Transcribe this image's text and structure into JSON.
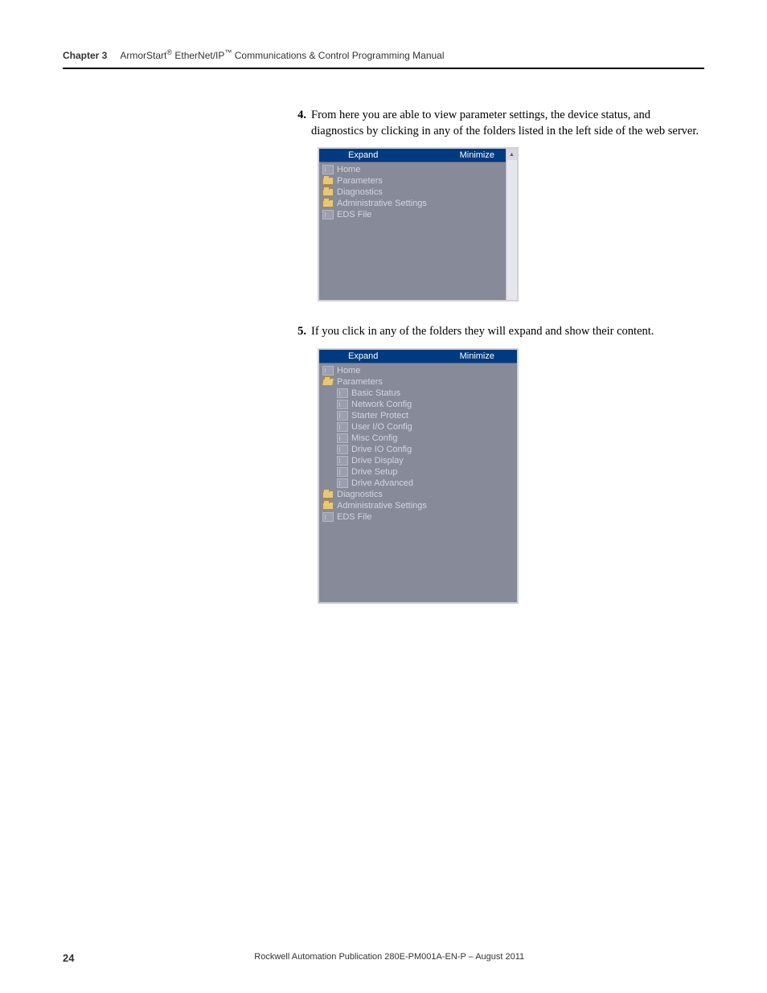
{
  "header": {
    "chapter": "Chapter 3",
    "title_parts": {
      "p1": "ArmorStart",
      "sup1": "®",
      "p2": " EtherNet/IP",
      "sup2": "™",
      "p3": " Communications & Control Programming Manual"
    }
  },
  "steps": {
    "s4": {
      "num": "4.",
      "text": "From here you are able to view parameter settings, the device status, and diagnostics by clicking in any of the folders listed in the left side of the web server."
    },
    "s5": {
      "num": "5.",
      "text": "If you click in any of the folders they will expand and show their content."
    }
  },
  "nav": {
    "expand": "Expand",
    "minimize": "Minimize",
    "panel1": {
      "items": {
        "home": "Home",
        "parameters": "Parameters",
        "diagnostics": "Diagnostics",
        "admin": "Administrative Settings",
        "eds": "EDS File"
      }
    },
    "panel2": {
      "items": {
        "home": "Home",
        "parameters": "Parameters",
        "basic_status": "Basic Status",
        "network_config": "Network Config",
        "starter_protect": "Starter Protect",
        "user_io_config": "User I/O Config",
        "misc_config": "Misc Config",
        "drive_io_config": "Drive IO Config",
        "drive_display": "Drive Display",
        "drive_setup": "Drive Setup",
        "drive_advanced": "Drive Advanced",
        "diagnostics": "Diagnostics",
        "admin": "Administrative Settings",
        "eds": "EDS File"
      }
    }
  },
  "footer": {
    "page": "24",
    "publication": "Rockwell Automation Publication 280E-PM001A-EN-P – August 2011"
  }
}
